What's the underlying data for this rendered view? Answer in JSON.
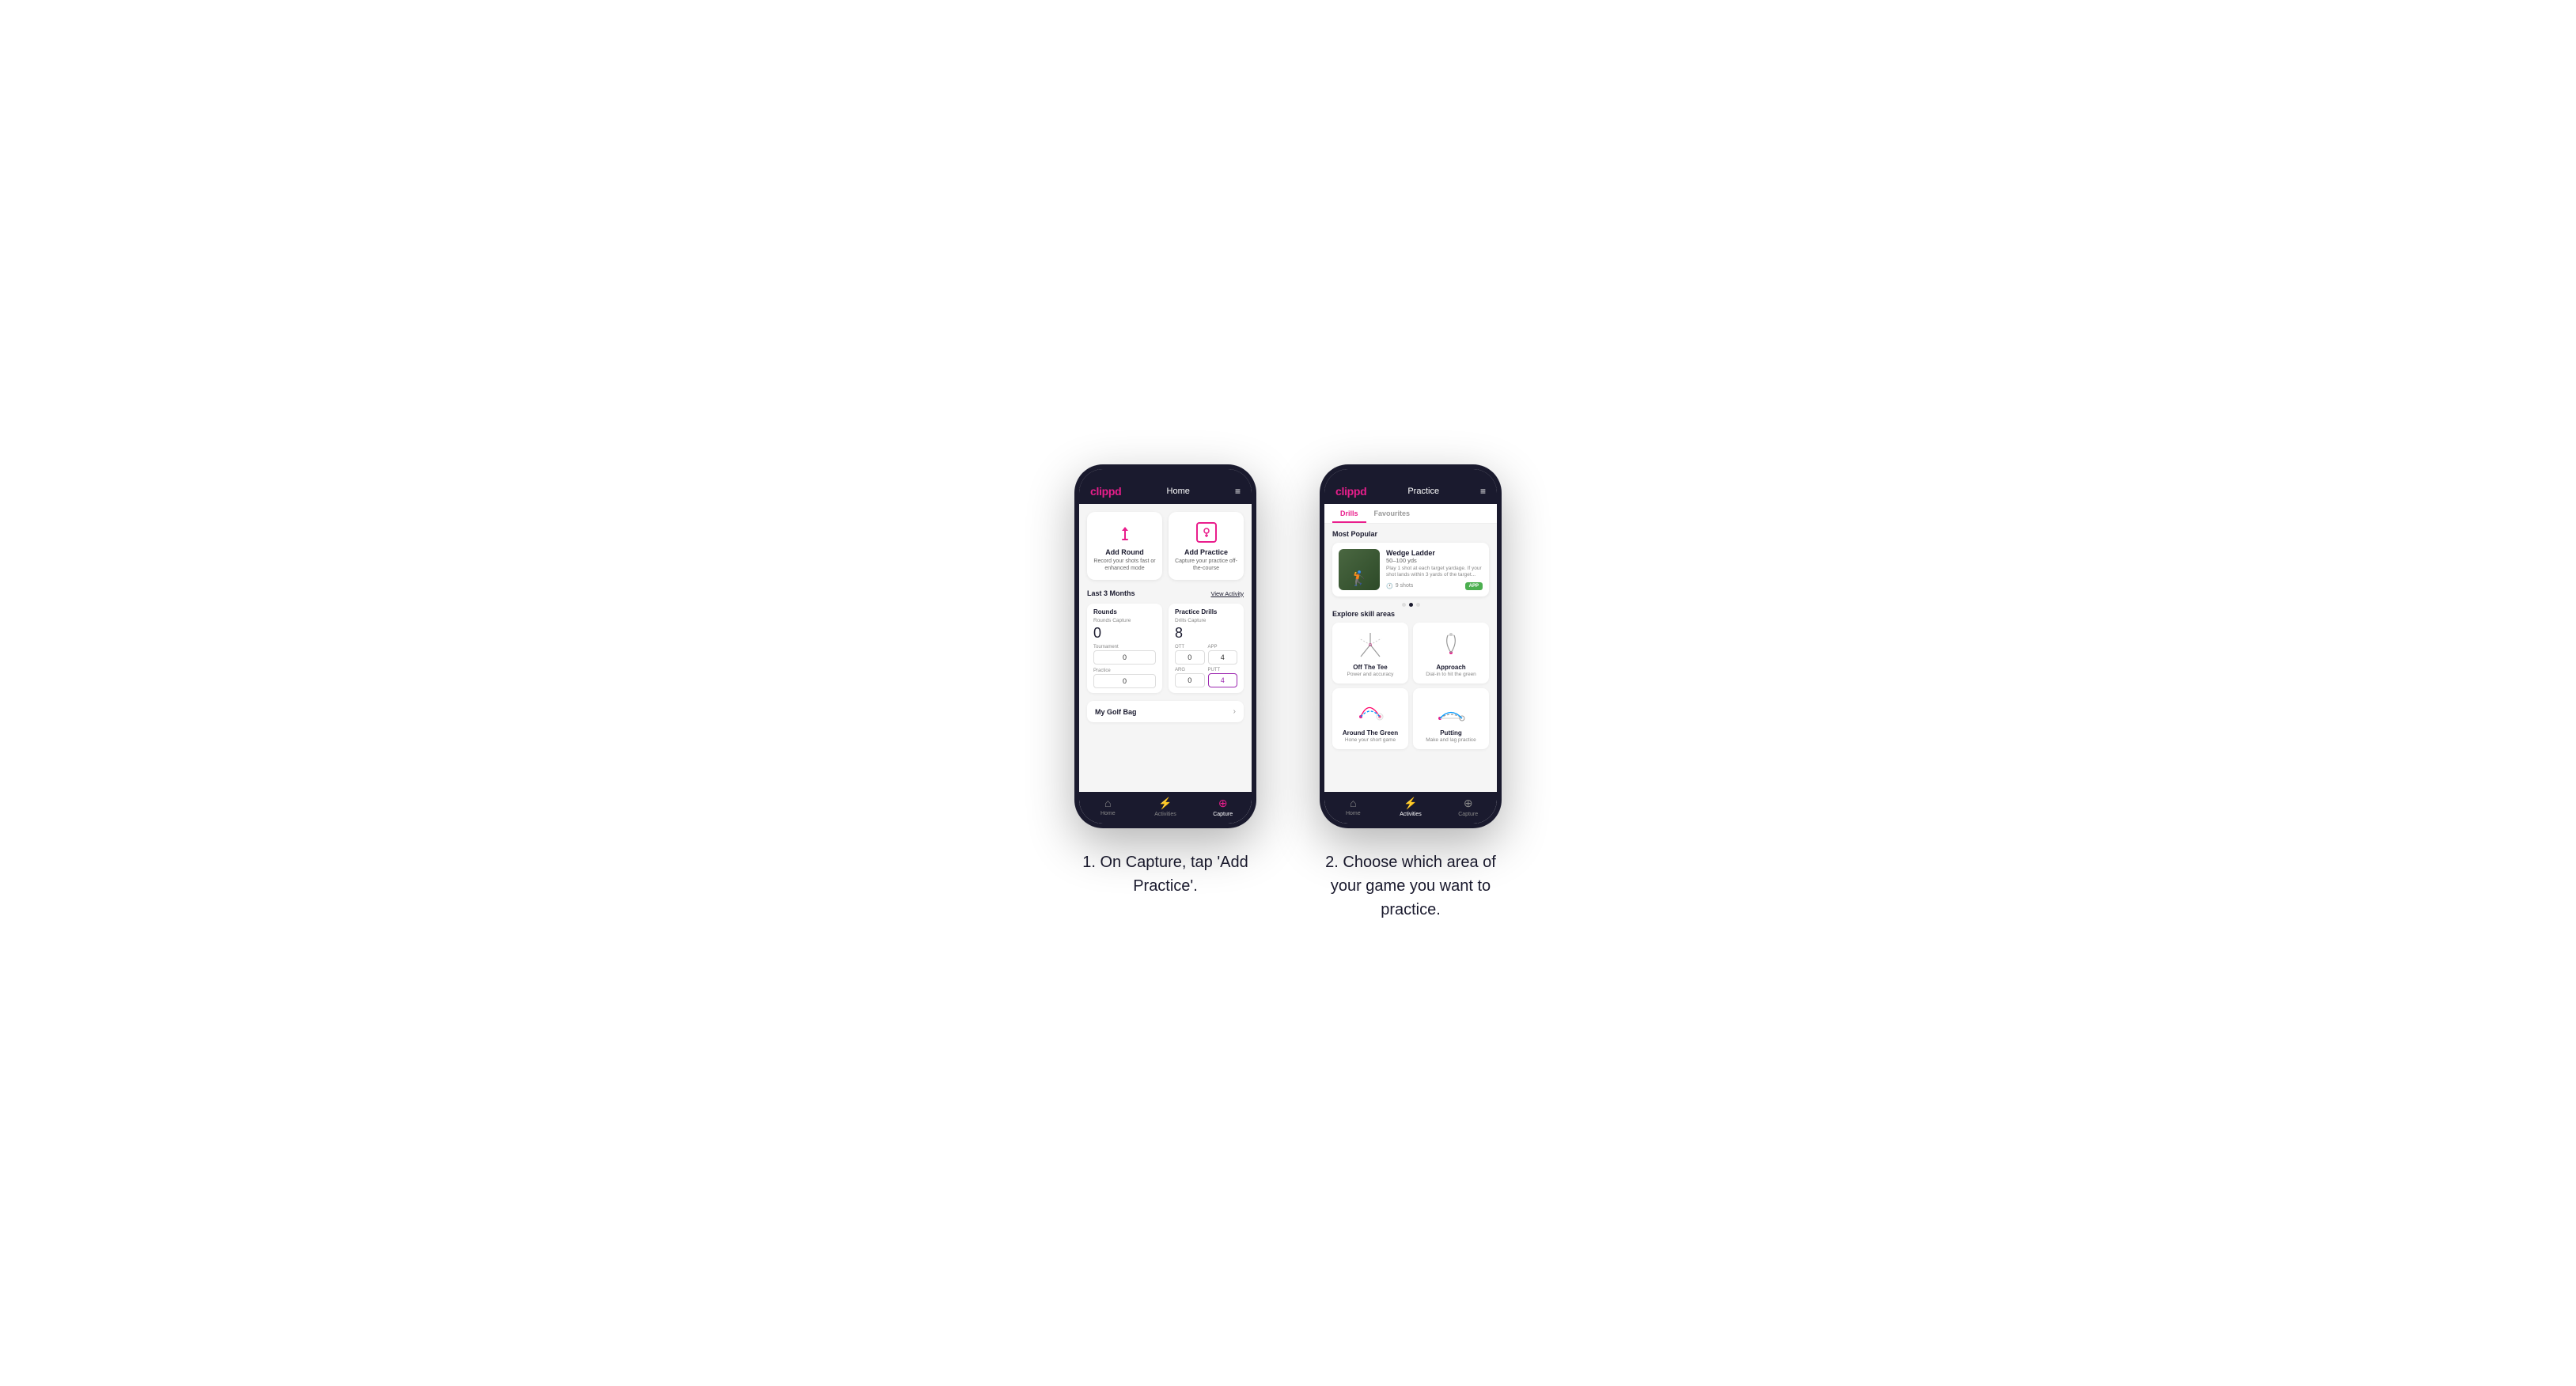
{
  "phone1": {
    "header": {
      "logo": "clippd",
      "title": "Home",
      "menu_icon": "≡"
    },
    "add_round": {
      "title": "Add Round",
      "subtitle": "Record your shots fast or enhanced mode"
    },
    "add_practice": {
      "title": "Add Practice",
      "subtitle": "Capture your practice off-the-course"
    },
    "stats": {
      "period": "Last 3 Months",
      "view_activity": "View Activity",
      "rounds": {
        "title": "Rounds",
        "capture_label": "Rounds Capture",
        "total": "0",
        "tournament_label": "Tournament",
        "tournament_value": "0",
        "practice_label": "Practice",
        "practice_value": "0"
      },
      "practice_drills": {
        "title": "Practice Drills",
        "capture_label": "Drills Capture",
        "total": "8",
        "ott_label": "OTT",
        "ott_value": "0",
        "app_label": "APP",
        "app_value": "4",
        "arg_label": "ARG",
        "arg_value": "0",
        "putt_label": "PUTT",
        "putt_value": "4"
      }
    },
    "golf_bag": {
      "label": "My Golf Bag"
    },
    "nav": {
      "home_label": "Home",
      "activities_label": "Activities",
      "capture_label": "Capture",
      "active": "capture"
    }
  },
  "phone2": {
    "header": {
      "logo": "clippd",
      "title": "Practice",
      "menu_icon": "≡"
    },
    "tabs": {
      "drills": "Drills",
      "favourites": "Favourites",
      "active": "drills"
    },
    "most_popular": {
      "title": "Most Popular",
      "featured": {
        "name": "Wedge Ladder",
        "yardage": "50–100 yds",
        "description": "Play 1 shot at each target yardage. If your shot lands within 3 yards of the target...",
        "shots": "9 shots",
        "badge": "APP"
      },
      "dots": [
        false,
        true,
        false
      ]
    },
    "explore": {
      "title": "Explore skill areas",
      "skills": [
        {
          "id": "off-the-tee",
          "title": "Off The Tee",
          "subtitle": "Power and accuracy"
        },
        {
          "id": "approach",
          "title": "Approach",
          "subtitle": "Dial-in to hit the green"
        },
        {
          "id": "around-the-green",
          "title": "Around The Green",
          "subtitle": "Hone your short game"
        },
        {
          "id": "putting",
          "title": "Putting",
          "subtitle": "Make and lag practice"
        }
      ]
    },
    "nav": {
      "home_label": "Home",
      "activities_label": "Activities",
      "capture_label": "Capture",
      "active": "activities"
    }
  },
  "caption1": "1. On Capture, tap 'Add Practice'.",
  "caption2": "2. Choose which area of your game you want to practice."
}
